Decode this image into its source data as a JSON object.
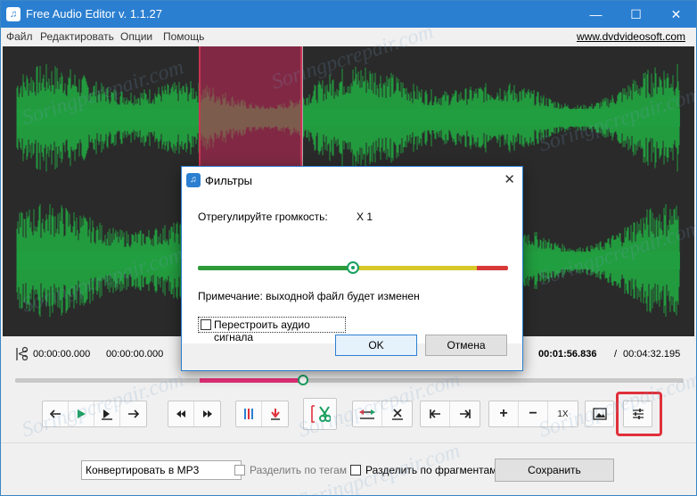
{
  "window": {
    "title": "Free Audio Editor v. 1.1.27",
    "app_icon_glyph": "♫",
    "controls": {
      "minimize": "—",
      "maximize": "☐",
      "close": "✕"
    }
  },
  "menu": {
    "items": [
      "Файл",
      "Редактировать",
      "Опции",
      "Помощь"
    ],
    "site_link": "www.dvdvideosoft.com"
  },
  "timeline": {
    "selection_start": "00:00:00.000",
    "selection_end": "00:00:00.000",
    "current_time": "00:01:56.836",
    "separator": "/",
    "total_time": "00:04:32.195",
    "position_progress": 0.43
  },
  "toolbar": {
    "icons": {
      "rewind": "back-arrow-icon",
      "play": "play-icon",
      "step": "step-icon",
      "forward": "forward-arrow-icon",
      "prev": "prev-icon",
      "next": "next-icon",
      "marker": "marker-icon",
      "insert": "insert-down-icon",
      "cut": "scissors-icon",
      "split": "split-icon",
      "delete": "delete-icon",
      "go_start": "go-start-icon",
      "go_end": "go-end-icon",
      "zoom_in": "+",
      "zoom_out": "−",
      "zoom_level": "1X",
      "image": "image-icon",
      "filters": "sliders-icon"
    }
  },
  "bottom": {
    "format_select": "Конвертировать в MP3",
    "split_by_tags": "Разделить по тегам",
    "split_by_fragments": "Разделить по фрагментам",
    "save_button": "Сохранить"
  },
  "dialog": {
    "title": "Фильтры",
    "volume_label": "Отрегулируйте громкость:",
    "volume_value": "X 1",
    "volume_position": 0.5,
    "note": "Примечание: выходной файл будет изменен",
    "rebuild_checkbox": "Перестроить аудио сигнала",
    "ok": "OK",
    "cancel": "Отмена"
  },
  "watermark": "Soringpcrepair.com",
  "colors": {
    "accent": "#2b7fd1",
    "wave": "#22a040",
    "selection": "#c8285a",
    "highlight": "#e0303a",
    "vol_green": "#2e9a3a",
    "vol_yellow": "#d8c82a",
    "vol_red": "#d83838"
  }
}
